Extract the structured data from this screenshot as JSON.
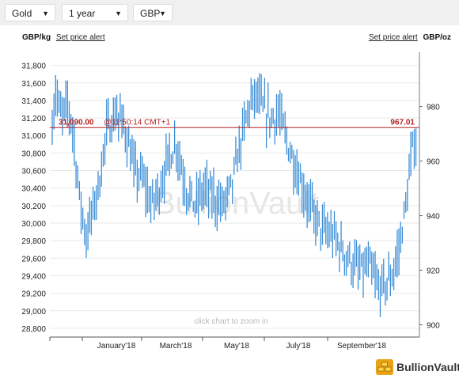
{
  "controls": {
    "metal": "Gold",
    "period": "1 year",
    "currency": "GBP"
  },
  "header": {
    "left_unit": "GBP/kg",
    "left_alert": "Set price alert",
    "right_alert": "Set price alert",
    "right_unit": "GBP/oz"
  },
  "colors": {
    "series": "#3d8fd8",
    "refline": "#b22222",
    "watermark": "#e6e6e6"
  },
  "brand": {
    "name": "BullionVault",
    "icon": "gold-bars-icon"
  },
  "chart_data": {
    "type": "line",
    "subtype": "ohlc-range",
    "x_labels": [
      "January'18",
      "March'18",
      "May'18",
      "July'18",
      "September'18"
    ],
    "y_left_ticks": [
      28800,
      29000,
      29200,
      29400,
      29600,
      29800,
      30000,
      30200,
      30400,
      30600,
      30800,
      31000,
      31200,
      31400,
      31600,
      31800
    ],
    "y_left_tick_labels": [
      "28,800",
      "29,000",
      "29,200",
      "29,400",
      "29,600",
      "29,800",
      "30,000",
      "30,200",
      "30,400",
      "30,600",
      "30,800",
      "31,000",
      "31,200",
      "31,400",
      "31,600",
      "31,800"
    ],
    "ylim_left": [
      28700,
      31950
    ],
    "y_right_ticks": [
      900,
      920,
      940,
      960,
      980
    ],
    "ylim_right": [
      895.5,
      999.9
    ],
    "last_left_label": "31,090.00",
    "last_time_label": "@11:50:14 CMT+1",
    "last_right_label": "967.01",
    "last_value": 31090.0,
    "watermark": "BullionVault",
    "zoom_hint": "click chart to zoom in",
    "anchors": [
      {
        "d": 0,
        "v": 31150
      },
      {
        "d": 3,
        "v": 31500
      },
      {
        "d": 8,
        "v": 31200
      },
      {
        "d": 14,
        "v": 31350
      },
      {
        "d": 18,
        "v": 31100
      },
      {
        "d": 24,
        "v": 30300
      },
      {
        "d": 30,
        "v": 29850
      },
      {
        "d": 36,
        "v": 30150
      },
      {
        "d": 42,
        "v": 30500
      },
      {
        "d": 48,
        "v": 31050
      },
      {
        "d": 56,
        "v": 31250
      },
      {
        "d": 64,
        "v": 31100
      },
      {
        "d": 72,
        "v": 30600
      },
      {
        "d": 80,
        "v": 30500
      },
      {
        "d": 88,
        "v": 30200
      },
      {
        "d": 96,
        "v": 30450
      },
      {
        "d": 104,
        "v": 30800
      },
      {
        "d": 110,
        "v": 30900
      },
      {
        "d": 118,
        "v": 30400
      },
      {
        "d": 126,
        "v": 30200
      },
      {
        "d": 134,
        "v": 30400
      },
      {
        "d": 142,
        "v": 30300
      },
      {
        "d": 150,
        "v": 30200
      },
      {
        "d": 158,
        "v": 30400
      },
      {
        "d": 166,
        "v": 30900
      },
      {
        "d": 174,
        "v": 31350
      },
      {
        "d": 180,
        "v": 31450
      },
      {
        "d": 188,
        "v": 31250
      },
      {
        "d": 194,
        "v": 31200
      },
      {
        "d": 200,
        "v": 31250
      },
      {
        "d": 208,
        "v": 30900
      },
      {
        "d": 216,
        "v": 30600
      },
      {
        "d": 224,
        "v": 30300
      },
      {
        "d": 232,
        "v": 30050
      },
      {
        "d": 240,
        "v": 29900
      },
      {
        "d": 248,
        "v": 29850
      },
      {
        "d": 256,
        "v": 29700
      },
      {
        "d": 264,
        "v": 29550
      },
      {
        "d": 272,
        "v": 29450
      },
      {
        "d": 280,
        "v": 29500
      },
      {
        "d": 288,
        "v": 29250
      },
      {
        "d": 294,
        "v": 29300
      },
      {
        "d": 300,
        "v": 29400
      },
      {
        "d": 306,
        "v": 29700
      },
      {
        "d": 312,
        "v": 30200
      },
      {
        "d": 318,
        "v": 30850
      },
      {
        "d": 322,
        "v": 31000
      }
    ]
  }
}
